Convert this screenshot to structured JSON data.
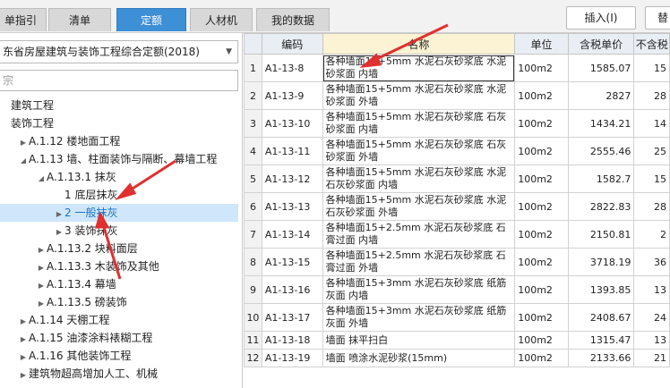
{
  "tabs": [
    "单指引",
    "清单",
    "定额",
    "人材机",
    "我的数据"
  ],
  "active_tab": 2,
  "buttons": {
    "insert": "插入(I)",
    "replace": "替"
  },
  "left": {
    "select_value": "东省房屋建筑与装饰工程综合定额(2018)",
    "search_placeholder": "宗",
    "tree": [
      {
        "label": "建筑工程",
        "indent": 0,
        "arrow": ""
      },
      {
        "label": "装饰工程",
        "indent": 0,
        "arrow": ""
      },
      {
        "label": "A.1.12 楼地面工程",
        "indent": 1,
        "arrow": "▶"
      },
      {
        "label": "A.1.13 墙、柱面装饰与隔断、幕墙工程",
        "indent": 1,
        "arrow": "◢"
      },
      {
        "label": "A.1.13.1 抹灰",
        "indent": 2,
        "arrow": "◢"
      },
      {
        "label": "1 底层抹灰",
        "indent": 3,
        "arrow": ""
      },
      {
        "label": "2 一般抹灰",
        "indent": 3,
        "arrow": "▶"
      },
      {
        "label": "3 装饰抹灰",
        "indent": 3,
        "arrow": "▶"
      },
      {
        "label": "A.1.13.2 块料面层",
        "indent": 2,
        "arrow": "▶"
      },
      {
        "label": "A.1.13.3 木装饰及其他",
        "indent": 2,
        "arrow": "▶"
      },
      {
        "label": "A.1.13.4 幕墙",
        "indent": 2,
        "arrow": "▶"
      },
      {
        "label": "A.1.13.5 磅装饰",
        "indent": 2,
        "arrow": "▶"
      },
      {
        "label": "A.1.14 天棚工程",
        "indent": 1,
        "arrow": "▶"
      },
      {
        "label": "A.1.15 油漆涂料裱糊工程",
        "indent": 1,
        "arrow": "▶"
      },
      {
        "label": "A.1.16 其他装饰工程",
        "indent": 1,
        "arrow": "▶"
      },
      {
        "label": "建筑物超高增加人工、机械",
        "indent": 1,
        "arrow": "▶"
      }
    ],
    "selected_index": 6
  },
  "table": {
    "headers": [
      "",
      "编码",
      "名称",
      "单位",
      "含税单价",
      "不含税"
    ],
    "rows": [
      {
        "n": "1",
        "code": "A1-13-8",
        "name": "各种墙面15+5mm 水泥石灰砂浆底 水泥砂浆面 内墙",
        "unit": "100m2",
        "price": "1585.07",
        "extra": "15"
      },
      {
        "n": "2",
        "code": "A1-13-9",
        "name": "各种墙面15+5mm 水泥石灰砂浆底 水泥砂浆面 外墙",
        "unit": "100m2",
        "price": "2827",
        "extra": "28"
      },
      {
        "n": "3",
        "code": "A1-13-10",
        "name": "各种墙面15+5mm 水泥石灰砂浆底 石灰砂浆面 内墙",
        "unit": "100m2",
        "price": "1434.21",
        "extra": "14"
      },
      {
        "n": "4",
        "code": "A1-13-11",
        "name": "各种墙面15+5mm 水泥石灰砂浆底 石灰砂浆面 外墙",
        "unit": "100m2",
        "price": "2555.46",
        "extra": "25"
      },
      {
        "n": "5",
        "code": "A1-13-12",
        "name": "各种墙面15+5mm 水泥石灰砂浆底 水泥石灰砂浆面 内墙",
        "unit": "100m2",
        "price": "1582.7",
        "extra": "15"
      },
      {
        "n": "6",
        "code": "A1-13-13",
        "name": "各种墙面15+5mm 水泥石灰砂浆底 水泥石灰砂浆面 外墙",
        "unit": "100m2",
        "price": "2822.83",
        "extra": "28"
      },
      {
        "n": "7",
        "code": "A1-13-14",
        "name": "各种墙面15+2.5mm 水泥石灰砂浆底 石膏过面 内墙",
        "unit": "100m2",
        "price": "2150.81",
        "extra": "2"
      },
      {
        "n": "8",
        "code": "A1-13-15",
        "name": "各种墙面15+2.5mm 水泥石灰砂浆底 石膏过面 外墙",
        "unit": "100m2",
        "price": "3718.19",
        "extra": "36"
      },
      {
        "n": "9",
        "code": "A1-13-16",
        "name": "各种墙面15+3mm 水泥石灰砂浆底 纸筋灰面 内墙",
        "unit": "100m2",
        "price": "1393.85",
        "extra": "13"
      },
      {
        "n": "10",
        "code": "A1-13-17",
        "name": "各种墙面15+3mm 水泥石灰砂浆底 纸筋灰面 外墙",
        "unit": "100m2",
        "price": "2408.67",
        "extra": "24"
      },
      {
        "n": "11",
        "code": "A1-13-18",
        "name": "墙面 抹平扫白",
        "unit": "100m2",
        "price": "1315.47",
        "extra": "13"
      },
      {
        "n": "12",
        "code": "A1-13-19",
        "name": "墙面 喷涂水泥砂浆(15mm)",
        "unit": "100m2",
        "price": "2133.66",
        "extra": "21"
      }
    ],
    "selected_row": 0
  },
  "colors": {
    "accent": "#3d8fd6",
    "arrow": "#e03030",
    "selection": "#cfe6fb"
  }
}
